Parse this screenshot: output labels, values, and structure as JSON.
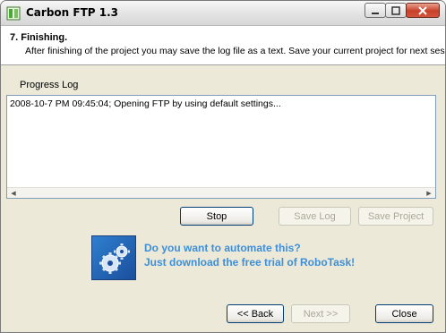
{
  "window": {
    "title": "Carbon FTP 1.3",
    "icon": "app-icon"
  },
  "header": {
    "step_title": "7. Finishing.",
    "step_description": "After finishing of the project you may save the log file as a text. Save your current project for next sessions."
  },
  "progress_log": {
    "label": "Progress Log",
    "lines": [
      "2008-10-7 PM 09:45:04; Opening FTP by using default settings..."
    ]
  },
  "actions": {
    "stop": "Stop",
    "save_log": "Save Log",
    "save_project": "Save Project"
  },
  "promo": {
    "line1": "Do you want to automate this?",
    "line2": "Just download the free trial of RoboTask!",
    "icon": "gears-icon",
    "color": "#3f8fd8"
  },
  "navigation": {
    "back": "<< Back",
    "next": "Next >>",
    "close": "Close"
  }
}
